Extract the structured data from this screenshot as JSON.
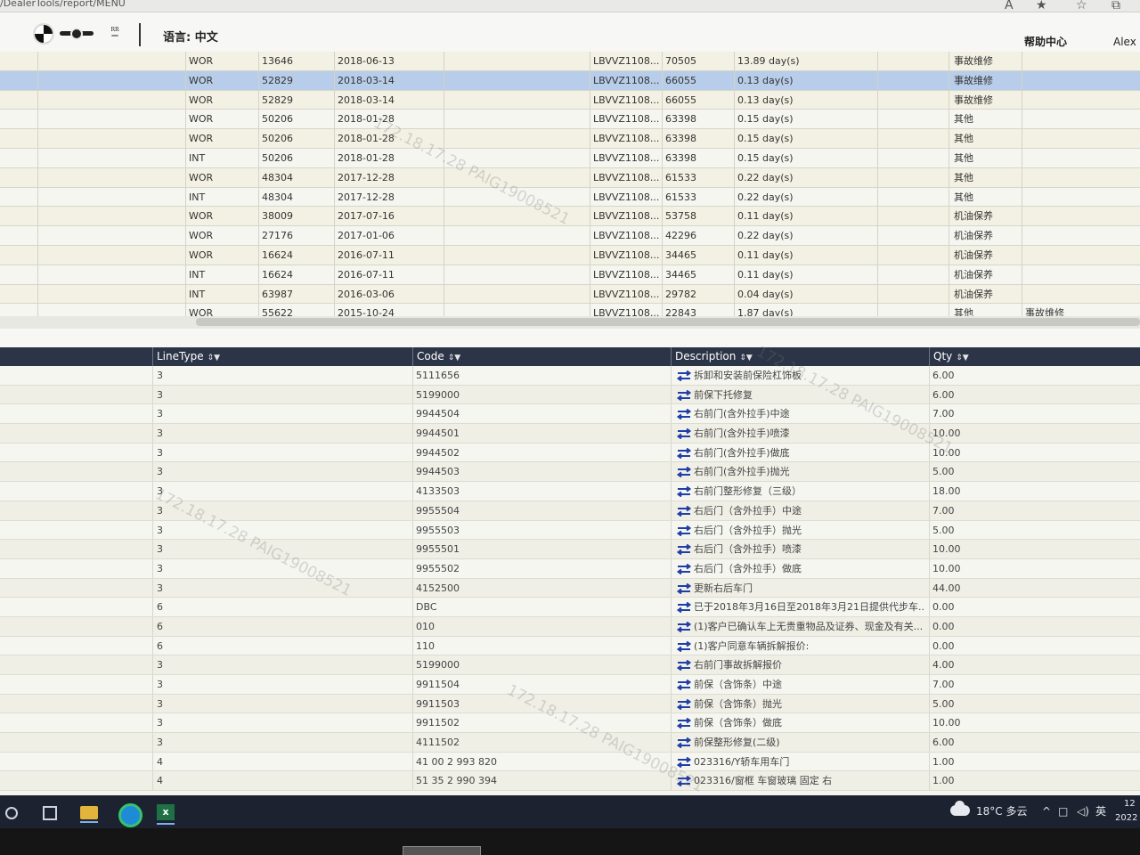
{
  "browser": {
    "url": "/DealerTools/report/MENU",
    "icons": [
      "font-size-icon",
      "star-icon",
      "favorites-icon",
      "collections-icon"
    ]
  },
  "header": {
    "language_label": "语言: 中文",
    "help": "帮助中心",
    "user": "Alex"
  },
  "top_table": {
    "rows": [
      {
        "type": "WOR",
        "no": "13646",
        "date": "2018-06-13",
        "vin": "LBVVZ1108...",
        "mileage": "70505",
        "days": "13.89 day(s)",
        "category": "事故维修",
        "extra": ""
      },
      {
        "type": "WOR",
        "no": "52829",
        "date": "2018-03-14",
        "vin": "LBVVZ1108...",
        "mileage": "66055",
        "days": "0.13 day(s)",
        "category": "事故维修",
        "extra": ""
      },
      {
        "type": "WOR",
        "no": "52829",
        "date": "2018-03-14",
        "vin": "LBVVZ1108...",
        "mileage": "66055",
        "days": "0.13 day(s)",
        "category": "事故维修",
        "extra": ""
      },
      {
        "type": "WOR",
        "no": "50206",
        "date": "2018-01-28",
        "vin": "LBVVZ1108...",
        "mileage": "63398",
        "days": "0.15 day(s)",
        "category": "其他",
        "extra": ""
      },
      {
        "type": "WOR",
        "no": "50206",
        "date": "2018-01-28",
        "vin": "LBVVZ1108...",
        "mileage": "63398",
        "days": "0.15 day(s)",
        "category": "其他",
        "extra": ""
      },
      {
        "type": "INT",
        "no": "50206",
        "date": "2018-01-28",
        "vin": "LBVVZ1108...",
        "mileage": "63398",
        "days": "0.15 day(s)",
        "category": "其他",
        "extra": ""
      },
      {
        "type": "WOR",
        "no": "48304",
        "date": "2017-12-28",
        "vin": "LBVVZ1108...",
        "mileage": "61533",
        "days": "0.22 day(s)",
        "category": "其他",
        "extra": ""
      },
      {
        "type": "INT",
        "no": "48304",
        "date": "2017-12-28",
        "vin": "LBVVZ1108...",
        "mileage": "61533",
        "days": "0.22 day(s)",
        "category": "其他",
        "extra": ""
      },
      {
        "type": "WOR",
        "no": "38009",
        "date": "2017-07-16",
        "vin": "LBVVZ1108...",
        "mileage": "53758",
        "days": "0.11 day(s)",
        "category": "机油保养",
        "extra": ""
      },
      {
        "type": "WOR",
        "no": "27176",
        "date": "2017-01-06",
        "vin": "LBVVZ1108...",
        "mileage": "42296",
        "days": "0.22 day(s)",
        "category": "机油保养",
        "extra": ""
      },
      {
        "type": "WOR",
        "no": "16624",
        "date": "2016-07-11",
        "vin": "LBVVZ1108...",
        "mileage": "34465",
        "days": "0.11 day(s)",
        "category": "机油保养",
        "extra": ""
      },
      {
        "type": "INT",
        "no": "16624",
        "date": "2016-07-11",
        "vin": "LBVVZ1108...",
        "mileage": "34465",
        "days": "0.11 day(s)",
        "category": "机油保养",
        "extra": ""
      },
      {
        "type": "INT",
        "no": "63987",
        "date": "2016-03-06",
        "vin": "LBVVZ1108...",
        "mileage": "29782",
        "days": "0.04 day(s)",
        "category": "机油保养",
        "extra": ""
      },
      {
        "type": "WOR",
        "no": "55622",
        "date": "2015-10-24",
        "vin": "LBVVZ1108...",
        "mileage": "22843",
        "days": "1.87 day(s)",
        "category": "其他",
        "extra": "事故维修"
      }
    ],
    "selected_row": 1
  },
  "bottom_table": {
    "headers": {
      "linetype": "LineType",
      "code": "Code",
      "description": "Description",
      "qty": "Qty"
    },
    "rows": [
      {
        "linetype": "3",
        "code": "5111656",
        "description": "拆卸和安装前保险杠饰板",
        "qty": "6.00"
      },
      {
        "linetype": "3",
        "code": "5199000",
        "description": "前保下托修复",
        "qty": "6.00"
      },
      {
        "linetype": "3",
        "code": "9944504",
        "description": "右前门(含外拉手)中途",
        "qty": "7.00"
      },
      {
        "linetype": "3",
        "code": "9944501",
        "description": "右前门(含外拉手)喷漆",
        "qty": "10.00"
      },
      {
        "linetype": "3",
        "code": "9944502",
        "description": "右前门(含外拉手)做底",
        "qty": "10.00"
      },
      {
        "linetype": "3",
        "code": "9944503",
        "description": "右前门(含外拉手)抛光",
        "qty": "5.00"
      },
      {
        "linetype": "3",
        "code": "4133503",
        "description": "右前门整形修复（三级）",
        "qty": "18.00"
      },
      {
        "linetype": "3",
        "code": "9955504",
        "description": "右后门（含外拉手）中途",
        "qty": "7.00"
      },
      {
        "linetype": "3",
        "code": "9955503",
        "description": "右后门（含外拉手）抛光",
        "qty": "5.00"
      },
      {
        "linetype": "3",
        "code": "9955501",
        "description": "右后门（含外拉手）喷漆",
        "qty": "10.00"
      },
      {
        "linetype": "3",
        "code": "9955502",
        "description": "右后门（含外拉手）做底",
        "qty": "10.00"
      },
      {
        "linetype": "3",
        "code": "4152500",
        "description": "更新右后车门",
        "qty": "44.00"
      },
      {
        "linetype": "6",
        "code": "DBC",
        "description": "已于2018年3月16日至2018年3月21日提供代步车...",
        "qty": "0.00"
      },
      {
        "linetype": "6",
        "code": "010",
        "description": "(1)客户已确认车上无贵重物品及证券、现金及有关...",
        "qty": "0.00"
      },
      {
        "linetype": "6",
        "code": "110",
        "description": "(1)客户同意车辆拆解报价:",
        "qty": "0.00"
      },
      {
        "linetype": "3",
        "code": "5199000",
        "description": "右前门事故拆解报价",
        "qty": "4.00"
      },
      {
        "linetype": "3",
        "code": "9911504",
        "description": "前保（含饰条）中途",
        "qty": "7.00"
      },
      {
        "linetype": "3",
        "code": "9911503",
        "description": "前保（含饰条）抛光",
        "qty": "5.00"
      },
      {
        "linetype": "3",
        "code": "9911502",
        "description": "前保（含饰条）做底",
        "qty": "10.00"
      },
      {
        "linetype": "3",
        "code": "4111502",
        "description": "前保整形修复(二级)",
        "qty": "6.00"
      },
      {
        "linetype": "4",
        "code": "41 00 2 993 820",
        "description": "023316/Y轿车用车门",
        "qty": "1.00"
      },
      {
        "linetype": "4",
        "code": "51 35 2 990 394",
        "description": "023316/窗框 车窗玻璃 固定 右",
        "qty": "1.00"
      }
    ]
  },
  "taskbar": {
    "weather": "18°C 多云",
    "ime": "英",
    "clock_time": "12",
    "clock_date": "2022"
  },
  "watermark": "172.18.17.28 PAIG19008521",
  "colors": {
    "header_bg": "#2c3547",
    "selected_row": "#b8cdea",
    "row_tint": "#f3f1e3",
    "icon_blue": "#1f3fa8"
  }
}
